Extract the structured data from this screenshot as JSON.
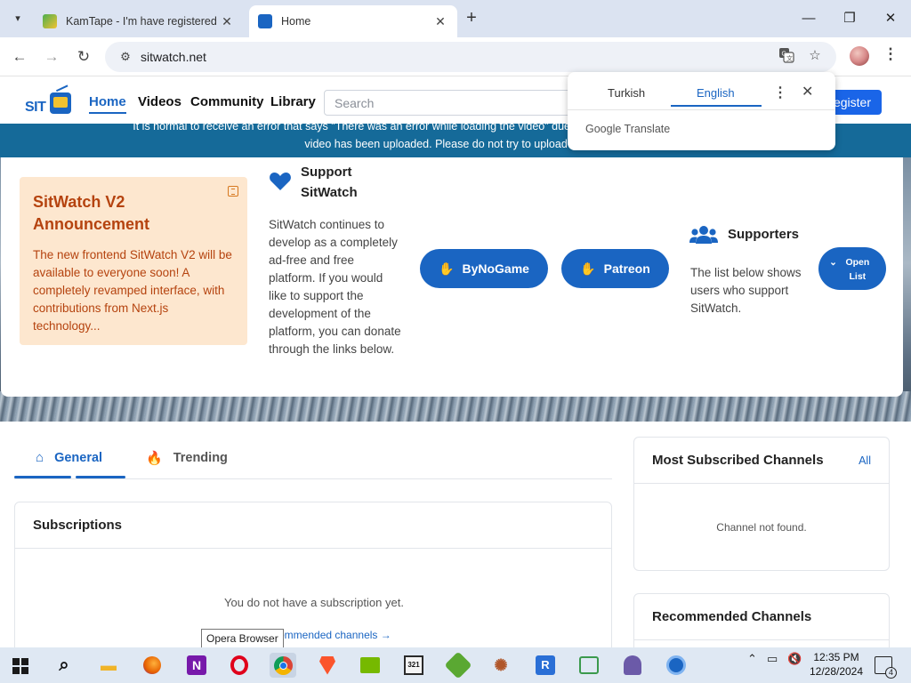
{
  "browser": {
    "tabs": [
      {
        "title": "KamTape - I'm have registered ",
        "active": false
      },
      {
        "title": "Home",
        "active": true
      }
    ],
    "url": "sitwatch.net",
    "icons": {
      "tab_search": "chevron-down-icon",
      "new_tab": "plus-icon",
      "back": "arrow-left-icon",
      "forward": "arrow-right-icon",
      "reload": "reload-icon",
      "site_info": "tune-icon",
      "translate": "translate-icon",
      "bookmark": "star-icon",
      "menu": "kebab-icon"
    }
  },
  "site": {
    "logo_text": "SIT",
    "nav": [
      "Home",
      "Videos",
      "Community",
      "Library"
    ],
    "search_placeholder": "Search",
    "register_label": "egister"
  },
  "banner": {
    "line1": "It is normal to receive an error that says \"There was an error while loading the video\" due to a problem. If you only rece                                                            video\", your",
    "line2": "video has been uploaded. Please do not try to upload it again"
  },
  "announcement": {
    "title": "SitWatch V2 Announcement",
    "body": "The new frontend SitWatch V2 will be available to everyone soon! A completely revamped interface, with contributions from Next.js technology..."
  },
  "support": {
    "title": "Support SitWatch",
    "text": "SitWatch continues to develop as a completely ad-free and free platform. If you would like to support the development of the platform, you can donate through the links below.",
    "buttons": [
      "ByNoGame",
      "Patreon"
    ]
  },
  "supporters": {
    "title": "Supporters",
    "text": "The list below shows users who support SitWatch.",
    "button": "Open List"
  },
  "content_tabs": [
    "General",
    "Trending"
  ],
  "subscriptions": {
    "title": "Subscriptions",
    "empty": "You do not have a subscription yet.",
    "link": "ommended channels →"
  },
  "most_subscribed": {
    "title": "Most Subscribed Channels",
    "all_label": "All",
    "empty": "Channel not found."
  },
  "recommended": {
    "title": "Recommended Channels"
  },
  "tooltip": "Opera Browser",
  "translate_popup": {
    "languages": [
      "Turkish",
      "English"
    ],
    "selected": "English",
    "brand": "Google Translate"
  },
  "taskbar": {
    "time": "12:35 PM",
    "date": "12/28/2024",
    "notification_count": "4",
    "app_colors": {
      "explorer": "#f0b428",
      "firefox": "#e66000",
      "onenote": "#7719aa",
      "opera": "#e0001b",
      "chrome": "#1a73e8",
      "brave": "#fb542b",
      "nvidia": "#76b900",
      "calendar": "#2a2a2a",
      "game": "#5aa832",
      "reader": "#2a6fd6",
      "mobility": "#3b9a4c",
      "ghost": "#6b5aa8",
      "blue": "#1a65c2"
    }
  },
  "colors": {
    "brand_blue": "#1a65c2",
    "banner_bg": "#156a99",
    "announce_bg": "#fde7cf",
    "announce_text": "#b5430f"
  }
}
